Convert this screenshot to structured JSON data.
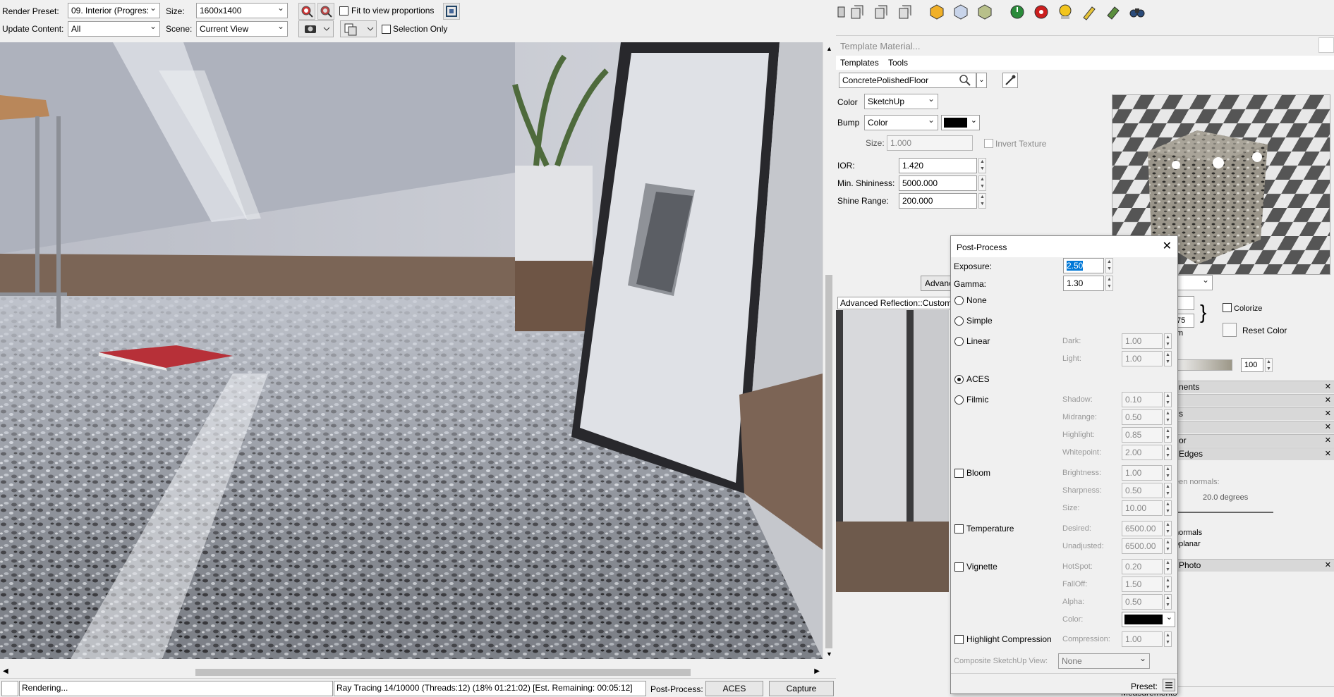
{
  "render_bar": {
    "preset_label": "Render Preset:",
    "preset_value": "09. Interior (Progres:",
    "size_label": "Size:",
    "size_value": "1600x1400",
    "fit_label": "Fit to view proportions",
    "update_label": "Update Content:",
    "update_value": "All",
    "scene_label": "Scene:",
    "scene_value": "Current View",
    "selection_only_label": "Selection Only"
  },
  "status_bar": {
    "rendering": "Rendering...",
    "progress": "Ray Tracing 14/10000 (Threads:12) (18% 01:21:02) [Est. Remaining: 00:05:12]",
    "postprocess_label": "Post-Process:",
    "postprocess_value": "ACES",
    "capture_label": "Capture"
  },
  "material": {
    "title": "Template Material...",
    "menu": [
      "Templates",
      "Tools"
    ],
    "name": "ConcretePolishedFloor",
    "color_label": "Color",
    "color_value": "SketchUp",
    "bump_label": "Bump",
    "bump_value": "Color",
    "bump_color": "#000000",
    "size_label": "Size:",
    "size_value": "1.000",
    "invert_label": "Invert Texture",
    "ior_label": "IOR:",
    "ior_value": "1.420",
    "min_shine_label": "Min. Shininess:",
    "min_shine_value": "5000.000",
    "shine_range_label": "Shine Range:",
    "shine_range_value": "200.000",
    "advanced_button": "Advanc",
    "advanced_reflection": "Advanced Reflection::Custom"
  },
  "styles_panel": {
    "colorize_label": "Colorize",
    "reset_color_label": "Reset Color",
    "slider_value": "100",
    "length_1": "",
    "length_2": "75 m",
    "rows": [
      "nents",
      "",
      "s",
      "",
      "or",
      "Edges"
    ],
    "normals_hint": "een normals:",
    "degrees": "20.0  degrees",
    "normals_check": "normals",
    "coplanar_check": "oplanar",
    "photo_row": "Photo",
    "measurements": "Measurements"
  },
  "postprocess": {
    "title": "Post-Process",
    "exposure_label": "Exposure:",
    "exposure_value": "2.50",
    "gamma_label": "Gamma:",
    "gamma_value": "1.30",
    "none": "None",
    "simple": "Simple",
    "linear": "Linear",
    "dark_label": "Dark:",
    "dark_value": "1.00",
    "light_label": "Light:",
    "light_value": "1.00",
    "aces": "ACES",
    "filmic": "Filmic",
    "shadow_label": "Shadow:",
    "shadow_value": "0.10",
    "midrange_label": "Midrange:",
    "midrange_value": "0.50",
    "highlight_label": "Highlight:",
    "highlight_value": "0.85",
    "whitepoint_label": "Whitepoint:",
    "whitepoint_value": "2.00",
    "bloom": "Bloom",
    "brightness_label": "Brightness:",
    "brightness_value": "1.00",
    "sharpness_label": "Sharpness:",
    "sharpness_value": "0.50",
    "bsize_label": "Size:",
    "bsize_value": "10.00",
    "temperature": "Temperature",
    "desired_label": "Desired:",
    "desired_value": "6500.00",
    "unadjusted_label": "Unadjusted:",
    "unadjusted_value": "6500.00",
    "vignette": "Vignette",
    "hotspot_label": "HotSpot:",
    "hotspot_value": "0.20",
    "falloff_label": "FallOff:",
    "falloff_value": "1.50",
    "alpha_label": "Alpha:",
    "alpha_value": "0.50",
    "color_label": "Color:",
    "vignette_color": "#000000",
    "highlight_comp": "Highlight Compression",
    "compression_label": "Compression:",
    "compression_value": "1.00",
    "composite_label": "Composite SketchUp View:",
    "composite_value": "None",
    "preset_label": "Preset:"
  },
  "colors": {
    "accent_selection": "#0078d7",
    "dialog_bg": "#f0f0f0",
    "pane_header": "#d8d8d8"
  }
}
